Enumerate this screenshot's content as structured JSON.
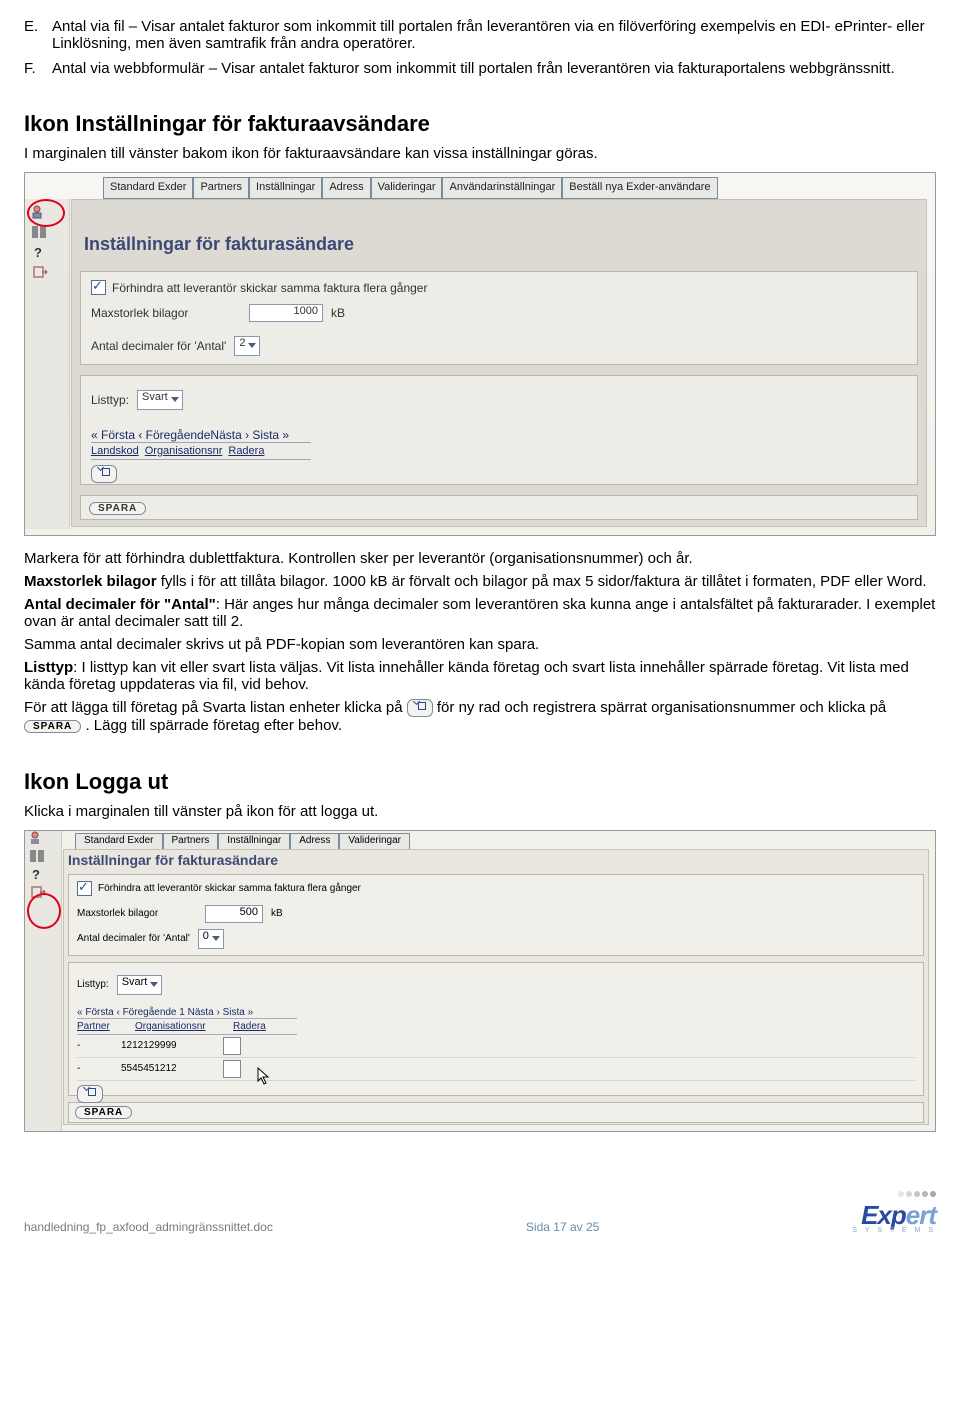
{
  "list": {
    "E": {
      "mark": "E.",
      "text": "Antal via fil – Visar antalet fakturor som inkommit till portalen från leverantören via en filöverföring exempelvis en EDI- ePrinter- eller Linklösning, men även samtrafik från andra operatörer."
    },
    "F": {
      "mark": "F.",
      "text": "Antal via webbformulär – Visar antalet fakturor som inkommit till portalen från leverantören via fakturaportalens webbgränssnitt."
    }
  },
  "section1": {
    "heading": "Ikon Inställningar för fakturaavsändare",
    "intro": "I marginalen till vänster bakom ikon för fakturaavsändare kan vissa inställningar göras."
  },
  "shot1": {
    "tabs": [
      "Standard Exder",
      "Partners",
      "Inställningar",
      "Adress",
      "Valideringar",
      "Användarinställningar",
      "Beställ nya Exder-användare"
    ],
    "title": "Inställningar för fakturasändare",
    "checkbox_label": "Förhindra att leverantör skickar samma faktura flera gånger",
    "max_label": "Maxstorlek bilagor",
    "max_value": "1000",
    "max_unit": "kB",
    "dec_label": "Antal decimaler för 'Antal'",
    "dec_value": "2",
    "listtyp_label": "Listtyp:",
    "listtyp_value": "Svart",
    "pager": "« Första ‹ FöregåendeNästa › Sista »",
    "th": {
      "c1": "Landskod",
      "c2": "Organisationsnr",
      "c3": "Radera"
    },
    "spara": "SPARA"
  },
  "body": {
    "p1": "Markera för att förhindra dublettfaktura. Kontrollen sker per leverantör (organisationsnummer) och år.",
    "p2a": "Maxstorlek bilagor",
    "p2b": " fylls i för att tillåta bilagor. 1000 kB är förvalt och bilagor på max 5 sidor/faktura är tillåtet i formaten, PDF eller Word.",
    "p3a": "Antal decimaler för \"Antal\"",
    "p3b": ": Här anges hur många decimaler som leverantören ska kunna ange i antalsfältet på fakturarader. I exemplet ovan är antal decimaler satt till 2.",
    "p4": "Samma antal decimaler skrivs ut på PDF-kopian som leverantören kan spara.",
    "p5a": "Listtyp",
    "p5b": ": I listtyp kan vit eller svart lista väljas. Vit lista innehåller kända företag och svart lista innehåller spärrade företag. Vit lista med kända företag uppdateras via fil, vid behov.",
    "p6a": "För att lägga till företag på Svarta listan enheter klicka på ",
    "p6b": " för ny rad och registrera spärrat organisationsnummer och klicka på ",
    "p6c": ". Lägg till spärrade företag efter behov."
  },
  "section2": {
    "heading": "Ikon Logga ut",
    "intro": "Klicka i marginalen till vänster på ikon för att logga ut."
  },
  "shot2": {
    "tabs": [
      "Standard Exder",
      "Partners",
      "Inställningar",
      "Adress",
      "Valideringar"
    ],
    "title": "Inställningar för fakturasändare",
    "checkbox_label": "Förhindra att leverantör skickar samma faktura flera gånger",
    "max_label": "Maxstorlek bilagor",
    "max_value": "500",
    "max_unit": "kB",
    "dec_label": "Antal decimaler för 'Antal'",
    "dec_value": "0",
    "listtyp_label": "Listtyp:",
    "listtyp_value": "Svart",
    "pager": "« Första ‹ Föregående 1 Nästa › Sista »",
    "th": {
      "c1": "Partner",
      "c2": "Organisationsnr",
      "c3": "Radera"
    },
    "rows": [
      {
        "partner": "-",
        "org": "1212129999"
      },
      {
        "partner": "-",
        "org": "5545451212"
      }
    ],
    "spara": "SPARA"
  },
  "footer": {
    "file": "handledning_fp_axfood_admingränssnittet.doc",
    "page": "Sida 17 av 25",
    "logo_main": "Exp",
    "logo_tail": "ert",
    "logo_sub": "S Y S T E M S"
  }
}
